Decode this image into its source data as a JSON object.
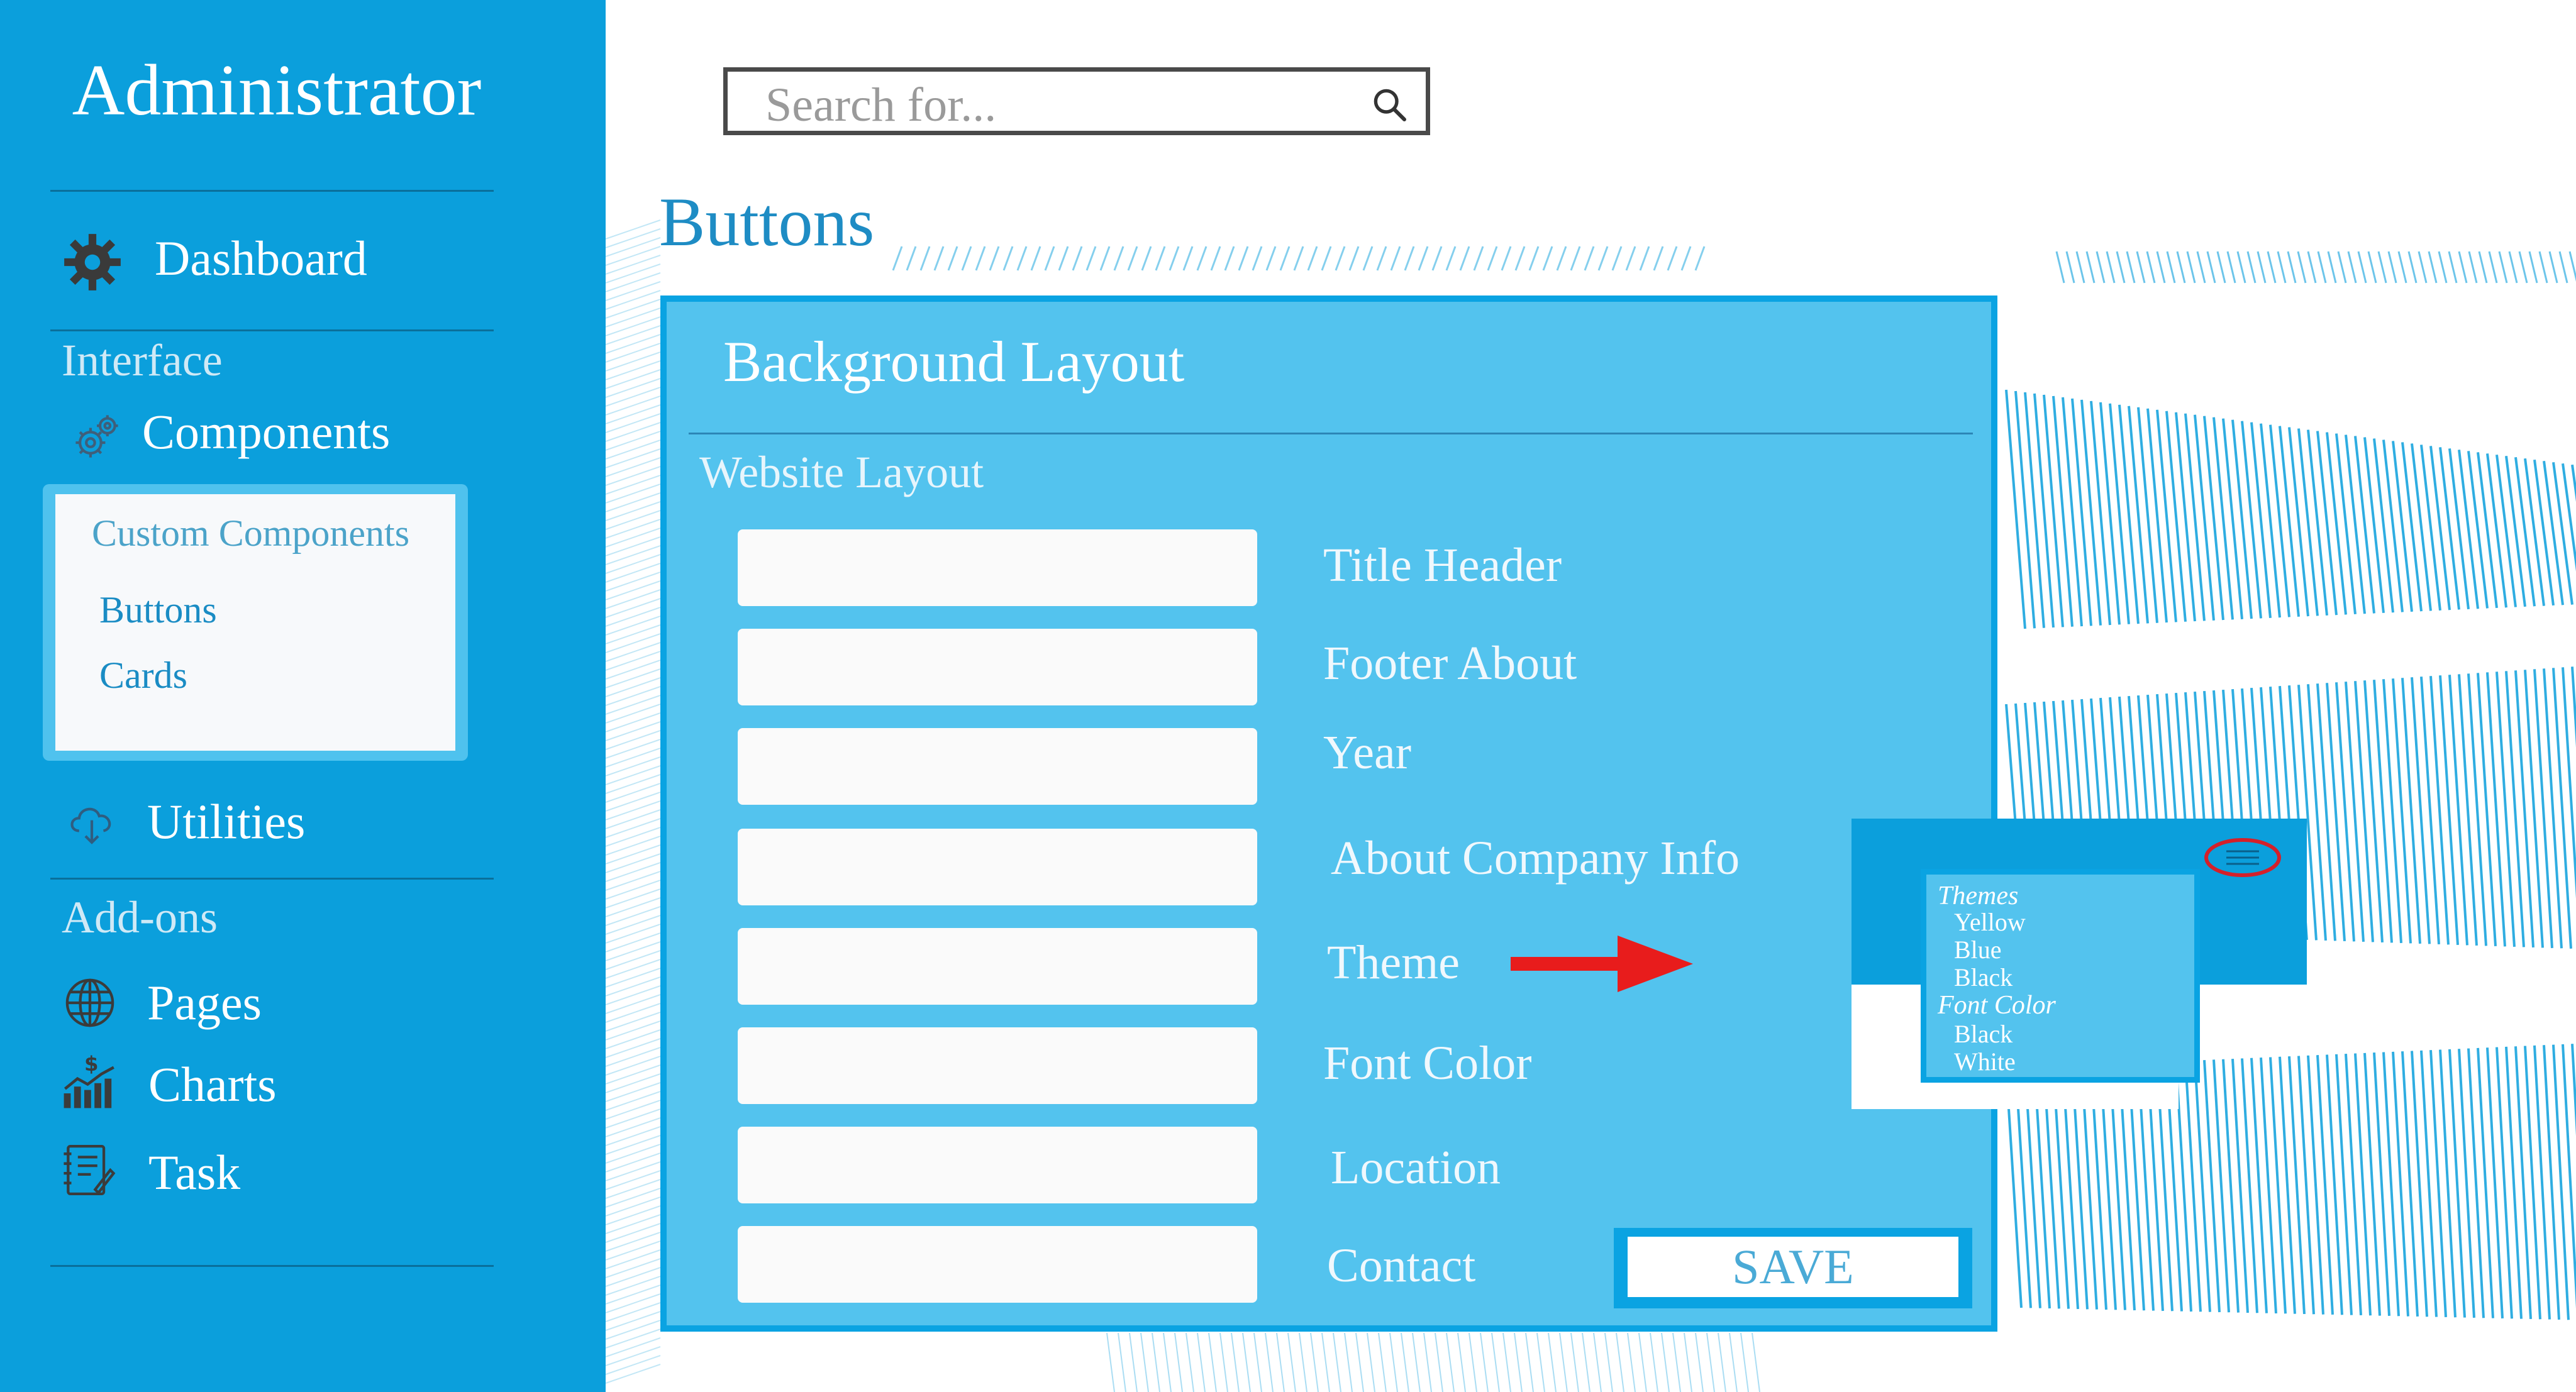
{
  "sidebar": {
    "title": "Administrator",
    "dashboard": "Dashboard",
    "section_interface": "Interface",
    "components": "Components",
    "custom_components": {
      "heading": "Custom Components",
      "links": [
        "Buttons",
        "Cards"
      ]
    },
    "utilities": "Utilities",
    "section_addons": "Add-ons",
    "pages": "Pages",
    "charts": "Charts",
    "task": "Task"
  },
  "search": {
    "placeholder": "Search for..."
  },
  "page_title": "Buttons",
  "card": {
    "title": "Background Layout",
    "subtitle": "Website Layout",
    "fields": [
      {
        "label": "Title Header",
        "value": ""
      },
      {
        "label": "Footer About",
        "value": ""
      },
      {
        "label": "Year",
        "value": ""
      },
      {
        "label": "About Company Info",
        "value": ""
      },
      {
        "label": "Theme",
        "value": ""
      },
      {
        "label": "Font Color",
        "value": ""
      },
      {
        "label": "Location",
        "value": ""
      },
      {
        "label": "Contact",
        "value": ""
      }
    ],
    "save_label": "SAVE"
  },
  "popup": {
    "themes_heading": "Themes",
    "themes": [
      "Yellow",
      "Blue",
      "Black"
    ],
    "font_color_heading": "Font Color",
    "font_colors": [
      "Black",
      "White"
    ]
  },
  "colors": {
    "sidebar_bg": "#0b9fdc",
    "card_bg": "#53c3ee",
    "accent": "#0aa3e2",
    "title_blue": "#1e8cc4",
    "arrow_red": "#e81c1c",
    "highlight_circle": "#d4202a"
  },
  "icons": {
    "dashboard": "gear-wrench-icon",
    "components": "gears-icon",
    "utilities": "cloud-download-icon",
    "pages": "globe-icon",
    "charts": "chart-money-icon",
    "task": "notebook-icon",
    "search": "search-icon",
    "menu": "hamburger-menu-icon"
  }
}
